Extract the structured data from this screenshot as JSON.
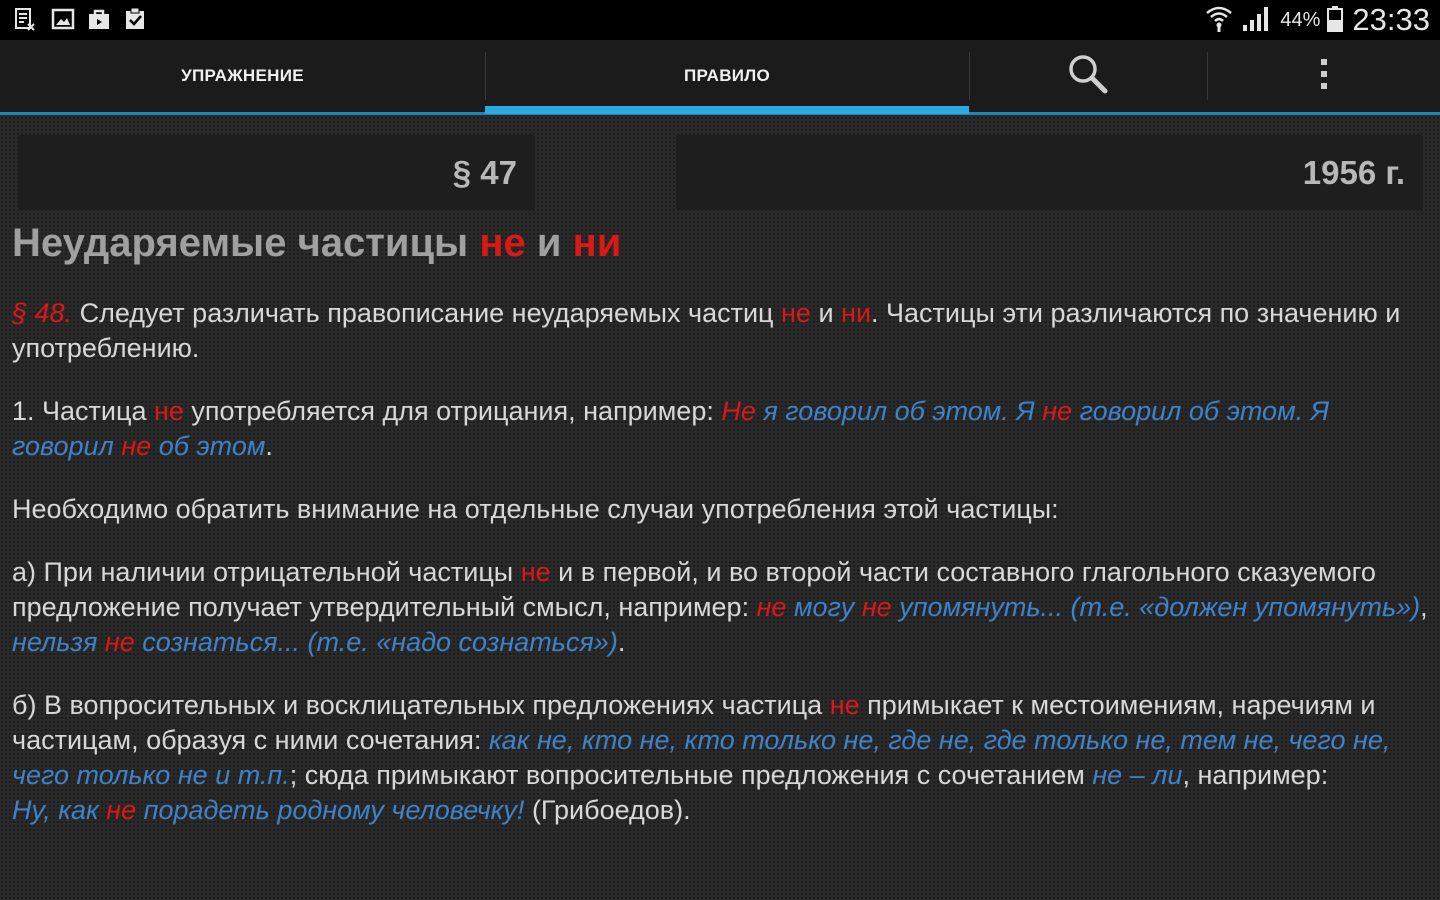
{
  "statusbar": {
    "icons_left": [
      "document-icon",
      "gallery-icon",
      "bag-icon",
      "clipboard-check-icon"
    ],
    "battery_percent": "44%",
    "time": "23:33"
  },
  "actionbar": {
    "tabs": [
      {
        "label": "УПРАЖНЕНИЕ",
        "selected": false
      },
      {
        "label": "ПРАВИЛО",
        "selected": true
      }
    ],
    "accent_color": "#2ea8e0"
  },
  "header": {
    "section": "§ 47",
    "year": "1956 г."
  },
  "article": {
    "title_main": "Неударяемые частицы",
    "title_p1": "не",
    "title_and": "и",
    "title_p2": "ни",
    "p1": {
      "ref": "§ 48.",
      "t1": " Следует различать правописание неударяемых частиц ",
      "r1": "не",
      "t2": " и ",
      "r2": "ни",
      "t3": ". Частицы эти различаются по значению и употреблению."
    },
    "p2": {
      "t1": "1. Частица ",
      "r1": "не",
      "t2": " употребляется для отрицания, например: ",
      "r2": "Не",
      "b1": " я говорил об этом. Я ",
      "r3": "не",
      "b2": " говорил об этом. Я говорил ",
      "r4": "не",
      "b3": " об этом",
      "t3": "."
    },
    "p3": {
      "t1": "Необходимо обратить внимание на отдельные случаи употребления этой частицы:"
    },
    "p4": {
      "t1": "а) При наличии отрицательной частицы ",
      "r1": "не",
      "t2": " и в первой, и во второй части составного глагольного сказуемого предложение получает утвердительный смысл, например: ",
      "r2": "не",
      "b1": " могу ",
      "r3": "не",
      "b2": " упомянуть... (т.е. «должен упомянуть»)",
      "t3": ", ",
      "b3": "нельзя ",
      "r4": "не",
      "b4": " сознаться... (т.е. «надо сознаться»)",
      "t4": "."
    },
    "p5": {
      "t1": "б) В вопросительных и восклицательных предложениях частица ",
      "r1": "не",
      "t2": " примыкает к местоимениям, наречиям и частицам, образуя с ними сочетания: ",
      "b1": "как не, кто не, кто только не, где не, где только не, тем не, чего не, чего только не и т.п.",
      "t3": "; сюда примыкают вопросительные предложения с сочетанием ",
      "b2": "не – ли",
      "t4": ", например:",
      "b3": "Ну, как ",
      "r2": "не",
      "b4": " порадеть родному человечку!",
      "t5": " (Грибоедов)."
    }
  }
}
